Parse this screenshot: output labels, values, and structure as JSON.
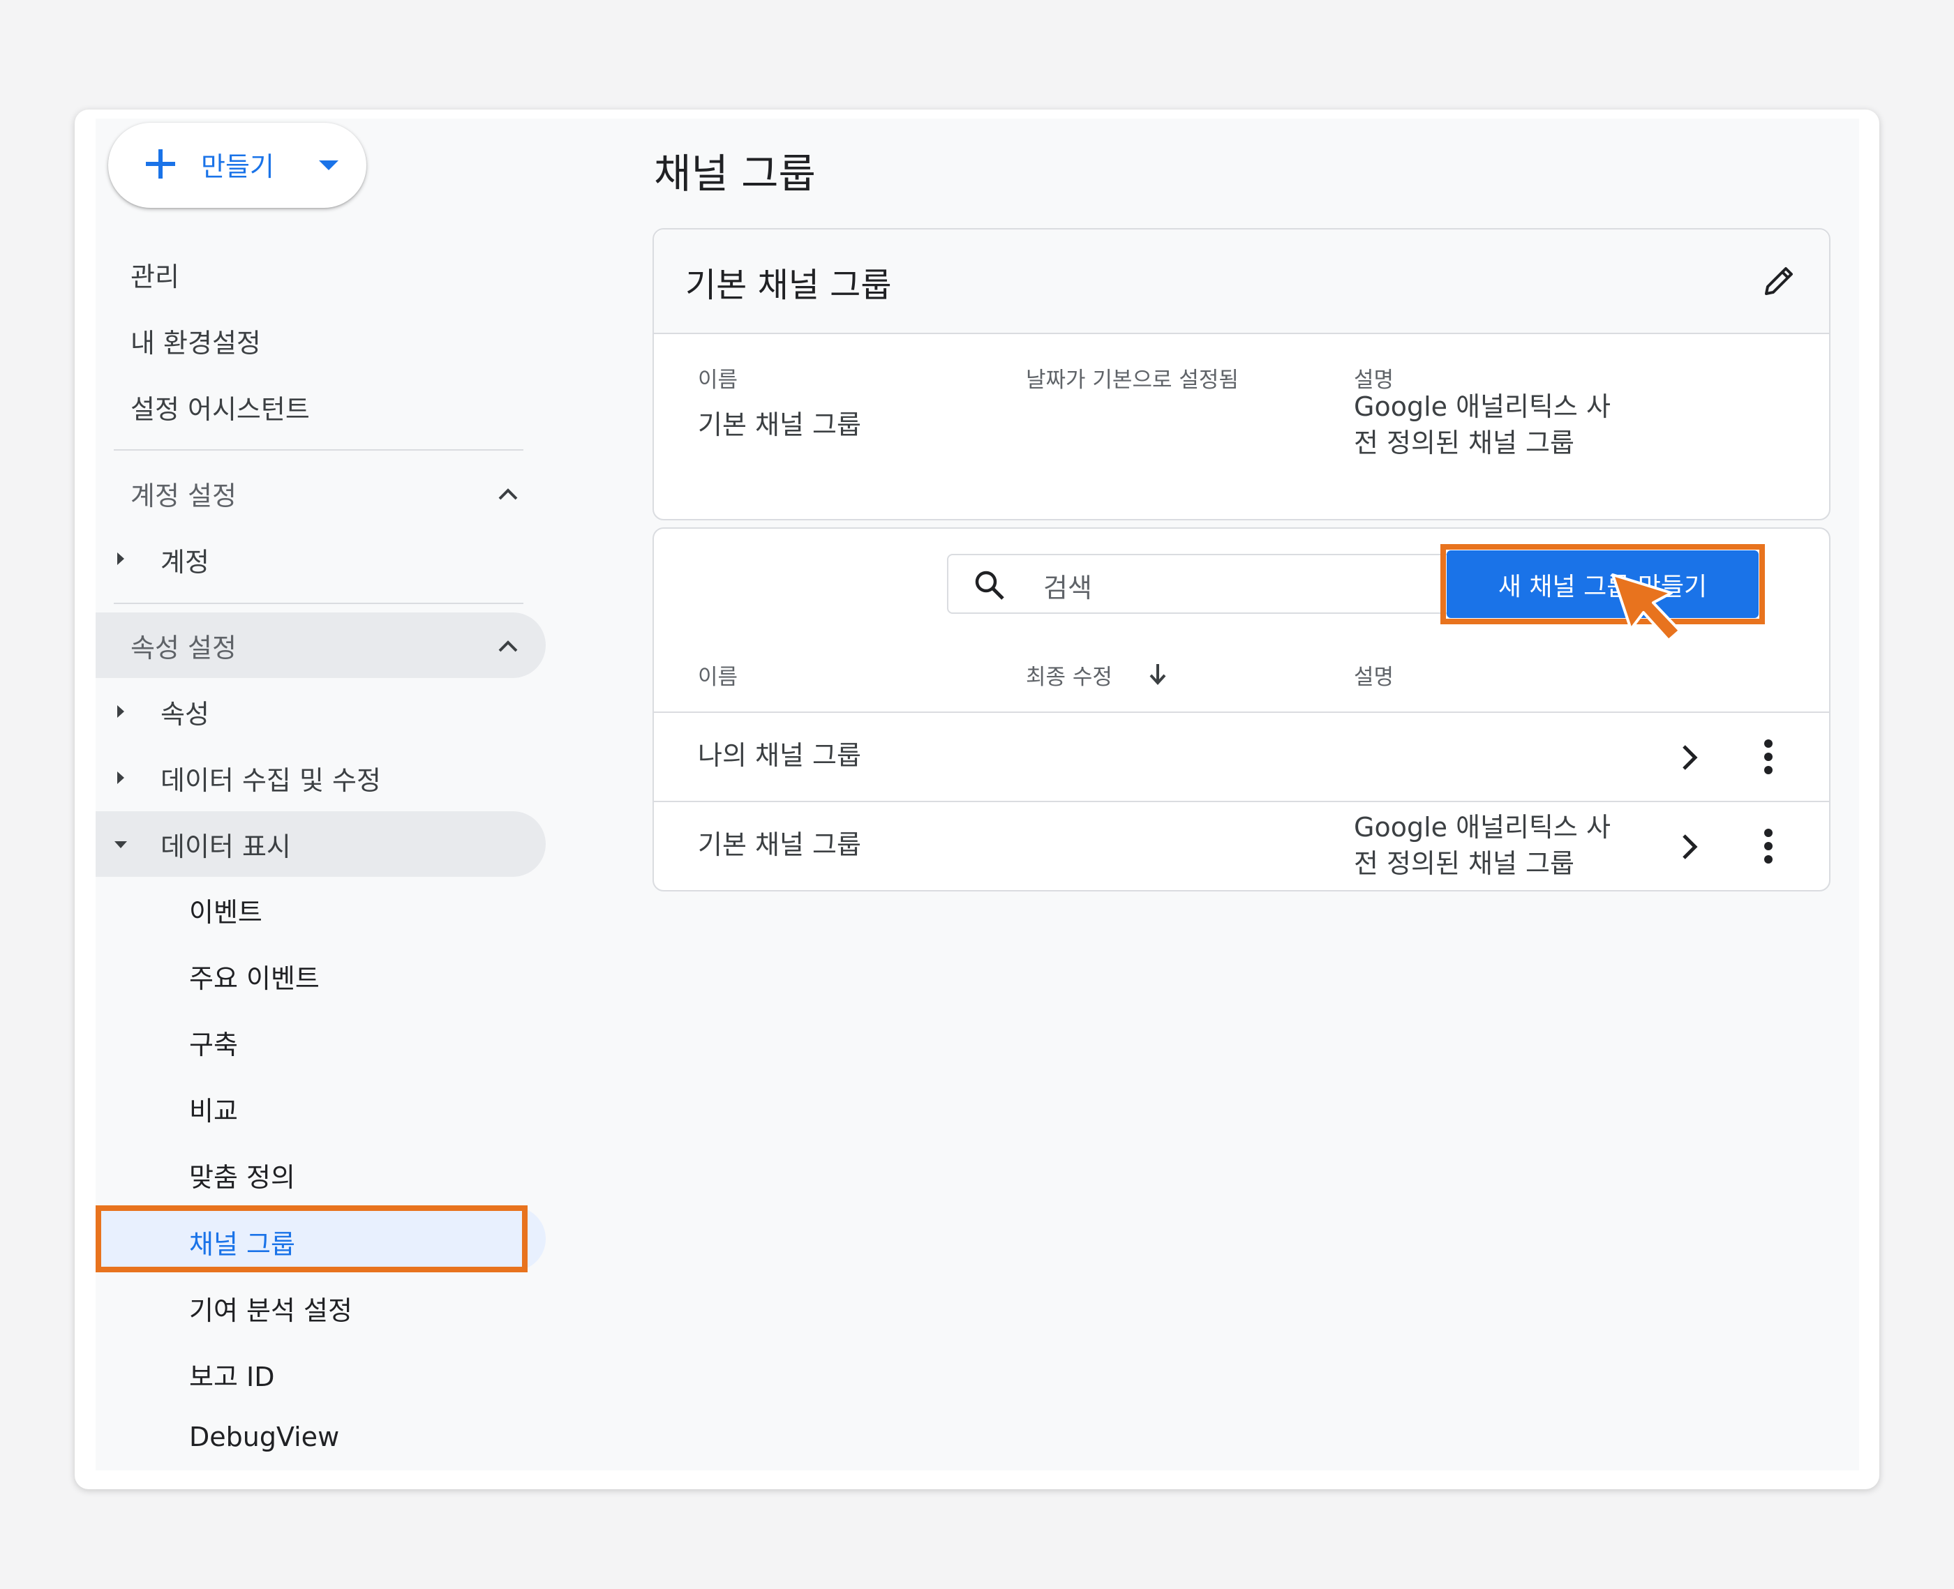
{
  "create_button": {
    "label": "만들기"
  },
  "sidebar": {
    "top_items": [
      {
        "label": "관리"
      },
      {
        "label": "내 환경설정"
      },
      {
        "label": "설정 어시스턴트"
      }
    ],
    "account_section": {
      "title": "계정 설정",
      "items": [
        {
          "label": "계정"
        }
      ]
    },
    "property_section": {
      "title": "속성 설정",
      "items": [
        {
          "label": "속성"
        },
        {
          "label": "데이터 수집 및 수정"
        },
        {
          "label": "데이터 표시"
        }
      ],
      "data_display_items": [
        {
          "label": "이벤트"
        },
        {
          "label": "주요 이벤트"
        },
        {
          "label": "구축"
        },
        {
          "label": "비교"
        },
        {
          "label": "맞춤 정의"
        },
        {
          "label": "채널 그룹"
        },
        {
          "label": "기여 분석 설정"
        },
        {
          "label": "보고 ID"
        },
        {
          "label": "DebugView"
        }
      ]
    }
  },
  "main": {
    "title": "채널 그룹",
    "default_card": {
      "title": "기본 채널 그룹",
      "headers": {
        "name": "이름",
        "default_date": "날짜가 기본으로 설정됨",
        "description": "설명"
      },
      "row": {
        "name": "기본 채널 그룹",
        "description_line1": "Google 애널리틱스 사",
        "description_line2": "전 정의된 채널 그룹"
      }
    },
    "list_card": {
      "search_placeholder": "검색",
      "create_button_label": "새 채널 그룹 만들기",
      "headers": {
        "name": "이름",
        "last_modified": "최종 수정",
        "description": "설명"
      },
      "rows": [
        {
          "name": "나의 채널 그룹",
          "description_line1": "",
          "description_line2": ""
        },
        {
          "name": "기본 채널 그룹",
          "description_line1": "Google 애널리틱스 사",
          "description_line2": "전 정의된 채널 그룹"
        }
      ]
    }
  },
  "colors": {
    "accent": "#1a73e8",
    "highlight": "#e8731e",
    "selected_bg": "#e8f0fe"
  },
  "icons": [
    "plus-icon",
    "dropdown-caret-icon",
    "chevron-up-icon",
    "expand-arrow-icon",
    "pencil-icon",
    "search-icon",
    "sort-arrow-down-icon",
    "chevron-right-icon",
    "more-vert-icon",
    "cursor-arrow-icon"
  ]
}
